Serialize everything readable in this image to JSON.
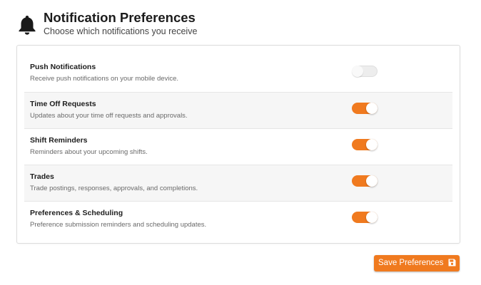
{
  "header": {
    "icon": "bell-icon",
    "title": "Notification Preferences",
    "subtitle": "Choose which notifications you receive"
  },
  "preferences": [
    {
      "title": "Push Notifications",
      "description": "Receive push notifications on your mobile device.",
      "enabled": false
    },
    {
      "title": "Time Off Requests",
      "description": "Updates about your time off requests and approvals.",
      "enabled": true
    },
    {
      "title": "Shift Reminders",
      "description": "Reminders about your upcoming shifts.",
      "enabled": true
    },
    {
      "title": "Trades",
      "description": "Trade postings, responses, approvals, and completions.",
      "enabled": true
    },
    {
      "title": "Preferences & Scheduling",
      "description": "Preference submission reminders and scheduling updates.",
      "enabled": true
    }
  ],
  "save_button": {
    "label": "Save Preferences",
    "icon": "floppy-disk-icon"
  },
  "colors": {
    "accent": "#f07a1f",
    "toggle_off": "#ededed"
  }
}
